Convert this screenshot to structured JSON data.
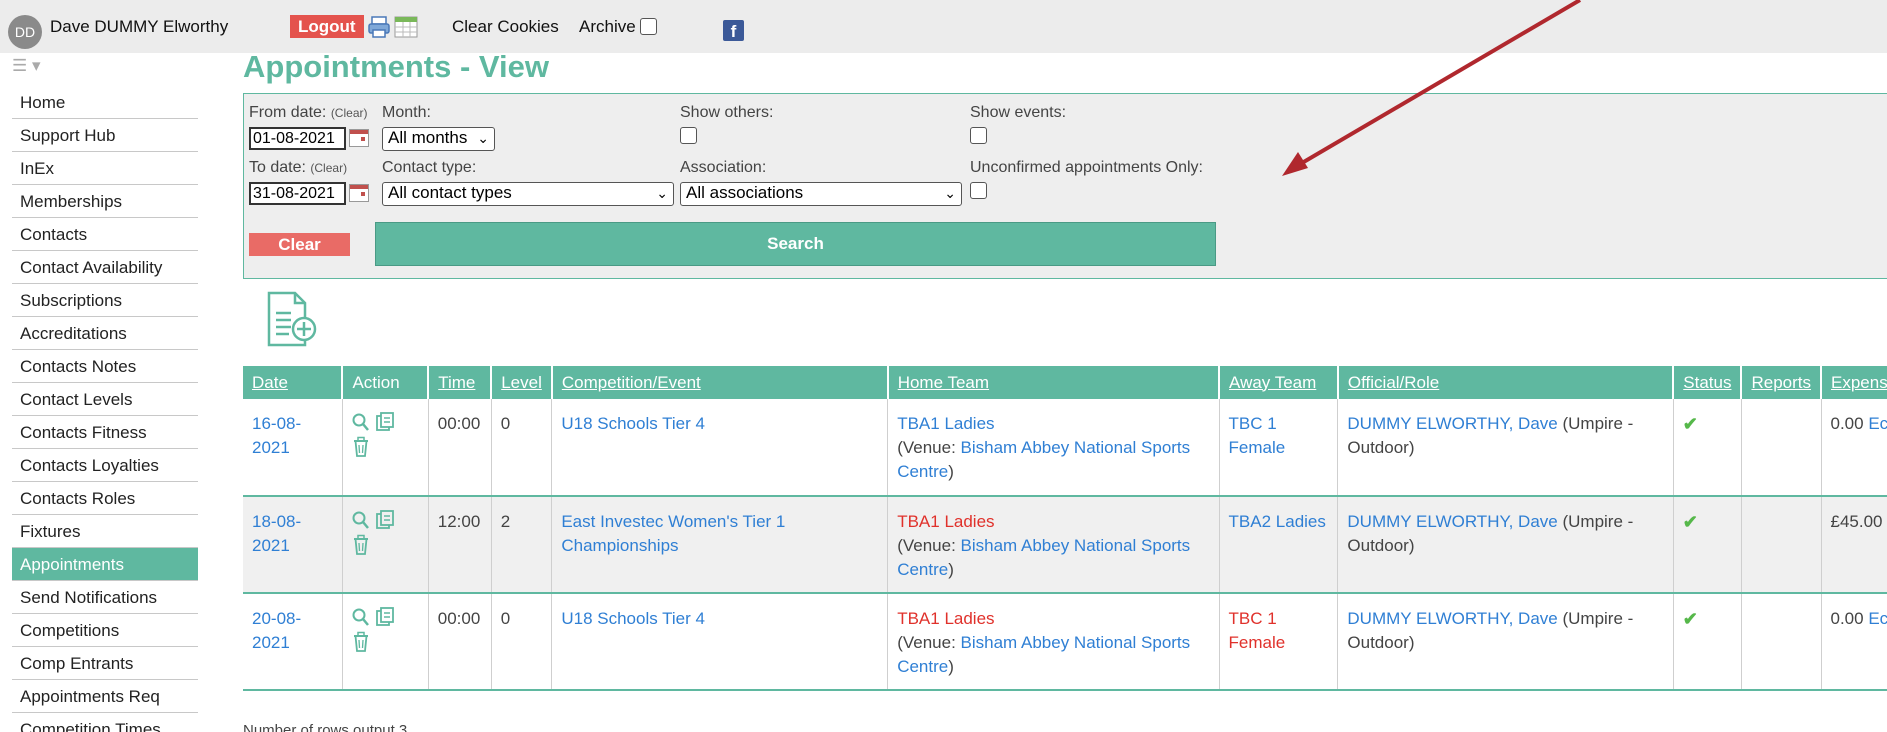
{
  "topbar": {
    "avatar_initials": "DD",
    "user_name": "Dave DUMMY Elworthy",
    "logout_label": "Logout",
    "clear_cookies_label": "Clear Cookies",
    "archive_label": "Archive",
    "facebook_glyph": "f"
  },
  "sidebar": {
    "items": [
      {
        "label": "Home"
      },
      {
        "label": "Support Hub"
      },
      {
        "label": "InEx"
      },
      {
        "label": "Memberships"
      },
      {
        "label": "Contacts"
      },
      {
        "label": "Contact Availability"
      },
      {
        "label": "Subscriptions"
      },
      {
        "label": "Accreditations"
      },
      {
        "label": "Contacts Notes"
      },
      {
        "label": "Contact Levels"
      },
      {
        "label": "Contacts Fitness"
      },
      {
        "label": "Contacts Loyalties"
      },
      {
        "label": "Contacts Roles"
      },
      {
        "label": "Fixtures"
      },
      {
        "label": "Appointments",
        "active": true
      },
      {
        "label": "Send Notifications"
      },
      {
        "label": "Competitions"
      },
      {
        "label": "Comp Entrants"
      },
      {
        "label": "Appointments Req"
      },
      {
        "label": "Competition Times"
      }
    ]
  },
  "page": {
    "title": "Appointments - View"
  },
  "filters": {
    "from_label": "From date:",
    "to_label": "To date:",
    "clear_small": "(Clear)",
    "from_value": "01-08-2021",
    "to_value": "31-08-2021",
    "month_label": "Month:",
    "month_value": "All months",
    "contact_type_label": "Contact type:",
    "contact_type_value": "All contact types",
    "show_others_label": "Show others:",
    "association_label": "Association:",
    "association_value": "All associations",
    "show_events_label": "Show events:",
    "unconfirmed_label": "Unconfirmed appointments Only:",
    "clear_button": "Clear",
    "search_button": "Search"
  },
  "table": {
    "headers": [
      "Date",
      "Action",
      "Time",
      "Level",
      "Competition/Event",
      "Home Team",
      "Away Team",
      "Official/Role",
      "Status",
      "Reports",
      "Expens"
    ],
    "rows": [
      {
        "date_a": "16-08-",
        "date_b": "2021",
        "time": "00:00",
        "level": "0",
        "competition_a": "U18 Schools Tier 4",
        "competition_b": "",
        "home_team": "TBA1 Ladies",
        "venue_prefix": "(Venue: ",
        "venue_a": "Bisham Abbey National Sports",
        "venue_b": "Centre",
        "venue_suffix": ")",
        "away_a": "TBC 1",
        "away_b": "Female",
        "official": "DUMMY ELWORTHY, Dave",
        "role_a": " (Umpire -",
        "role_b": "Outdoor)",
        "status": "✔",
        "reports": "",
        "expenses": "0.00",
        "expenses_link": "Ec"
      },
      {
        "date_a": "18-08-",
        "date_b": "2021",
        "time": "12:00",
        "level": "2",
        "competition_a": "East Investec Women's Tier 1",
        "competition_b": "Championships",
        "home_team": "TBA1 Ladies",
        "venue_prefix": "(Venue: ",
        "venue_a": "Bisham Abbey National Sports",
        "venue_b": "Centre",
        "venue_suffix": ")",
        "away_a": "TBA2 Ladies",
        "away_b": "",
        "official": "DUMMY ELWORTHY, Dave",
        "role_a": " (Umpire -",
        "role_b": "Outdoor)",
        "status": "✔",
        "reports": "",
        "expenses": "£45.00",
        "expenses_link": ""
      },
      {
        "date_a": "20-08-",
        "date_b": "2021",
        "time": "00:00",
        "level": "0",
        "competition_a": "U18 Schools Tier 4",
        "competition_b": "",
        "home_team": "TBA1 Ladies",
        "venue_prefix": "(Venue: ",
        "venue_a": "Bisham Abbey National Sports",
        "venue_b": "Centre",
        "venue_suffix": ")",
        "away_a": "TBC 1",
        "away_b": "Female",
        "official": "DUMMY ELWORTHY, Dave",
        "role_a": " (Umpire -",
        "role_b": "Outdoor)",
        "status": "✔",
        "reports": "",
        "expenses": "0.00",
        "expenses_link": "Ec"
      }
    ]
  },
  "footer": {
    "rows_output": "Number of rows output 3"
  },
  "colors": {
    "accent": "#5fb8a0",
    "link": "#2f7fd4",
    "alert": "#e0312b",
    "logout": "#e4534d",
    "arrow": "#b0282e"
  }
}
